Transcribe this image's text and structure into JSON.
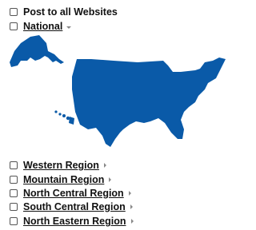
{
  "header": {
    "post_all_label": "Post to all Websites",
    "national_label": "National"
  },
  "map": {
    "fill_color": "#0a5aa8",
    "icon": "usa-map-icon"
  },
  "regions": [
    {
      "label": "Western Region"
    },
    {
      "label": "Mountain Region"
    },
    {
      "label": "North Central Region"
    },
    {
      "label": "South Central Region"
    },
    {
      "label": "North Eastern Region"
    }
  ]
}
